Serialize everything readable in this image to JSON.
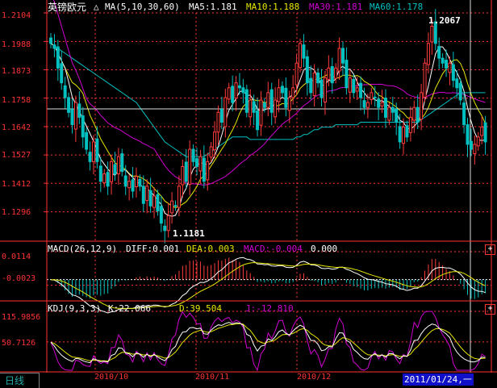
{
  "main_panel": {
    "symbol": "英镑欧元",
    "ma_label": "MA(5,10,30,60)",
    "ma5": "MA5:1.181",
    "ma10": "MA10:1.188",
    "ma30": "MA30:1.181",
    "ma60": "MA60:1.178",
    "y_ticks": [
      "1.2104",
      "1.1988",
      "1.1873",
      "1.1758",
      "1.1642",
      "1.1527",
      "1.1412",
      "1.1296"
    ],
    "high_label": "1.2067",
    "low_label": "1.1181"
  },
  "macd_panel": {
    "label": "MACD(26,12,9)",
    "diff": "DIFF:0.001",
    "dea": "DEA:0.003",
    "macd": "MACD:-0.004",
    "zero": "0.000",
    "y_ticks": [
      "0.0114",
      "-0.0023"
    ]
  },
  "kdj_panel": {
    "label": "KDJ(9,3,3)",
    "k": "K:22.066",
    "d": "D:39.504",
    "j": "J:-12.810",
    "y_ticks": [
      "115.9856",
      "50.7126"
    ]
  },
  "x_axis": {
    "ticks": [
      "2010/10",
      "2010/11",
      "2010/12"
    ]
  },
  "footer": {
    "period_tab": "日线",
    "cursor_date": "2011/01/24,一"
  },
  "icons": {
    "expand": "+",
    "ma_toggle": "△"
  },
  "colors": {
    "up": "#ff3c3c",
    "down": "#00c0c0",
    "ma5": "#ffffff",
    "ma10": "#e6e600",
    "ma30": "#d000d0",
    "ma60": "#00c0c0",
    "grid": "#ff3333",
    "dea": "#e6e600"
  },
  "chart_data": [
    {
      "type": "candlestick",
      "title": "英镑欧元",
      "x_ticks": [
        "2010/10",
        "2010/11",
        "2010/12"
      ],
      "ylim": [
        1.118,
        1.2104
      ],
      "close": [
        1.198,
        1.196,
        1.188,
        1.182,
        1.176,
        1.17,
        1.165,
        1.174,
        1.168,
        1.16,
        1.155,
        1.15,
        1.158,
        1.15,
        1.142,
        1.145,
        1.14,
        1.15,
        1.145,
        1.152,
        1.146,
        1.14,
        1.142,
        1.138,
        1.144,
        1.14,
        1.133,
        1.14,
        1.132,
        1.136,
        1.13,
        1.125,
        1.122,
        1.128,
        1.134,
        1.132,
        1.14,
        1.148,
        1.142,
        1.155,
        1.15,
        1.148,
        1.152,
        1.142,
        1.15,
        1.156,
        1.162,
        1.17,
        1.166,
        1.176,
        1.18,
        1.174,
        1.182,
        1.18,
        1.178,
        1.17,
        1.175,
        1.17,
        1.163,
        1.175,
        1.172,
        1.178,
        1.17,
        1.175,
        1.18,
        1.178,
        1.172,
        1.176,
        1.18,
        1.19,
        1.198,
        1.192,
        1.182,
        1.178,
        1.186,
        1.182,
        1.176,
        1.184,
        1.188,
        1.182,
        1.188,
        1.196,
        1.19,
        1.18,
        1.184,
        1.178,
        1.18,
        1.176,
        1.172,
        1.174,
        1.178,
        1.176,
        1.172,
        1.174,
        1.168,
        1.172,
        1.17,
        1.166,
        1.158,
        1.164,
        1.16,
        1.168,
        1.172,
        1.166,
        1.178,
        1.19,
        1.198,
        1.205,
        1.198,
        1.192,
        1.19,
        1.188,
        1.19,
        1.183,
        1.18,
        1.175,
        1.165,
        1.157,
        1.155,
        1.157,
        1.16,
        1.164,
        1.158
      ],
      "ma60": [
        1.198,
        1.197,
        1.196,
        1.195,
        1.194,
        1.193,
        1.192,
        1.191,
        1.19,
        1.189,
        1.188,
        1.187,
        1.186,
        1.185,
        1.184,
        1.183,
        1.182,
        1.181,
        1.18,
        1.179,
        1.178,
        1.177,
        1.176,
        1.175,
        1.174,
        1.172,
        1.17,
        1.168,
        1.166,
        1.164,
        1.162,
        1.16,
        1.158,
        1.157,
        1.156,
        1.155,
        1.154,
        1.153,
        1.152,
        1.152,
        1.152,
        1.152,
        1.152,
        1.152,
        1.153,
        1.154,
        1.155,
        1.156,
        1.157,
        1.158,
        1.159,
        1.16,
        1.16,
        1.16,
        1.16,
        1.16,
        1.159,
        1.159,
        1.159,
        1.159,
        1.159,
        1.159,
        1.159,
        1.159,
        1.159,
        1.159,
        1.159,
        1.159,
        1.159,
        1.16,
        1.16,
        1.161,
        1.161,
        1.162,
        1.163,
        1.163,
        1.164,
        1.164,
        1.164,
        1.164,
        1.165,
        1.165,
        1.165,
        1.165,
        1.165,
        1.165,
        1.165,
        1.166,
        1.166,
        1.166,
        1.166,
        1.166,
        1.166,
        1.166,
        1.166,
        1.166,
        1.166,
        1.166,
        1.166,
        1.166,
        1.166,
        1.166,
        1.166,
        1.166,
        1.167,
        1.168,
        1.169,
        1.17,
        1.171,
        1.172,
        1.173,
        1.174,
        1.175,
        1.176,
        1.177,
        1.178,
        1.178,
        1.178,
        1.178,
        1.178,
        1.178,
        1.178,
        1.178
      ]
    },
    {
      "type": "bar",
      "title": "MACD(26,12,9)",
      "ylim": [
        -0.008,
        0.0114
      ],
      "zero": 0.0
    },
    {
      "type": "line",
      "title": "KDJ(9,3,3)",
      "ylim": [
        0,
        115.9856
      ]
    }
  ]
}
